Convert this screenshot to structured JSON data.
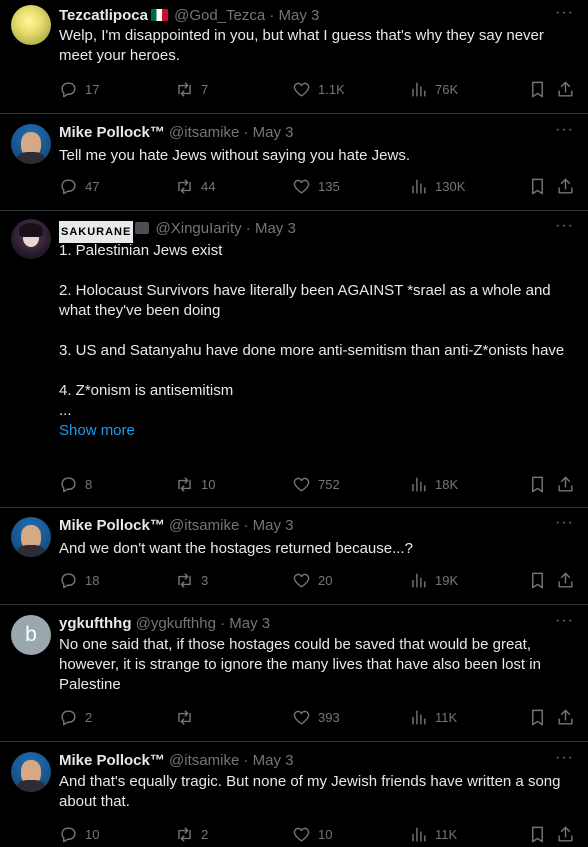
{
  "tweets": [
    {
      "name": "Tezcatlipoca",
      "handle": "@God_Tezca",
      "date": "May 3",
      "text": "Welp, I'm disappointed in you, but what I guess that's why they say never meet your heroes.",
      "replies": "17",
      "retweets": "7",
      "likes": "1.1K",
      "views": "76K"
    },
    {
      "name": "Mike Pollock™",
      "handle": "@itsamike",
      "date": "May 3",
      "text": "Tell me you hate Jews without saying you hate Jews.",
      "replies": "47",
      "retweets": "44",
      "likes": "135",
      "views": "130K"
    },
    {
      "name": "SAKURANE",
      "handle": "@XinguIarity",
      "date": "May 3",
      "lines": [
        "1. Palestinian Jews exist",
        "2. Holocaust Survivors have literally been AGAINST *srael as a whole and what they've been doing",
        "3. US and Satanyahu have done more anti-semitism than anti-Z*onists have",
        "4. Z*onism is antisemitism",
        "..."
      ],
      "show_more": "Show more",
      "replies": "8",
      "retweets": "10",
      "likes": "752",
      "views": "18K"
    },
    {
      "name": "Mike Pollock™",
      "handle": "@itsamike",
      "date": "May 3",
      "text": "And we don't want the hostages returned because...?",
      "replies": "18",
      "retweets": "3",
      "likes": "20",
      "views": "19K"
    },
    {
      "name": "ygkufthhg",
      "handle": "@ygkufthhg",
      "date": "May 3",
      "avatar_letter": "b",
      "text": "No one said that, if those hostages could be saved that would be great, however, it is strange to ignore the many lives that have also been lost in Palestine",
      "replies": "2",
      "retweets": "",
      "likes": "393",
      "views": "11K"
    },
    {
      "name": "Mike Pollock™",
      "handle": "@itsamike",
      "date": "May 3",
      "text": "And that's equally tragic. But none of my Jewish friends have written a song about that.",
      "replies": "10",
      "retweets": "2",
      "likes": "10",
      "views": "11K"
    }
  ],
  "separator": "·",
  "more_glyph": "···",
  "icons": [
    "reply-icon",
    "retweet-icon",
    "like-icon",
    "views-icon",
    "bookmark-icon",
    "share-icon",
    "more-icon"
  ]
}
